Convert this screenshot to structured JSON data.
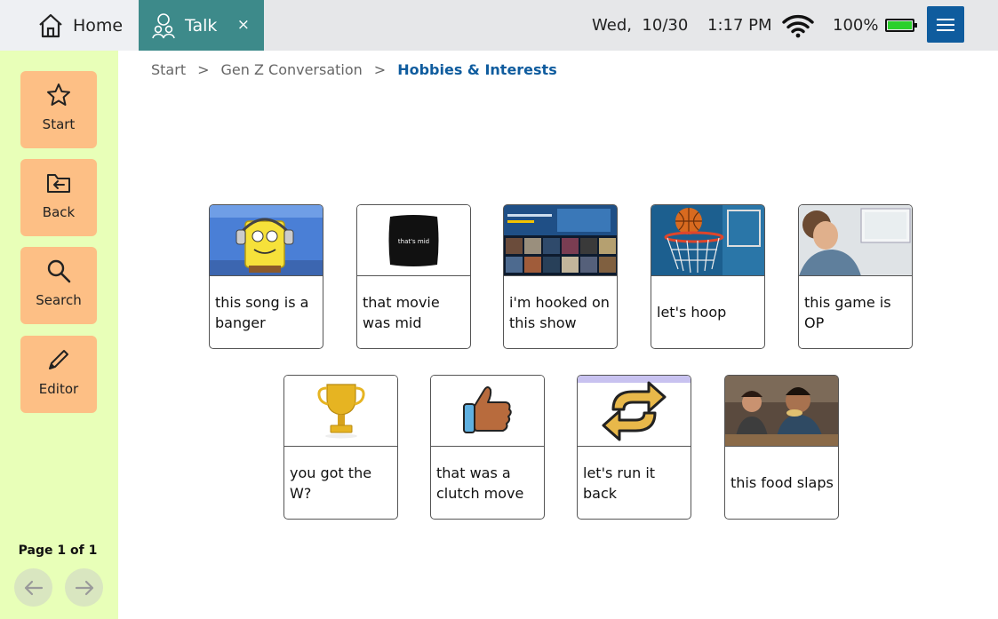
{
  "tabs": {
    "home_label": "Home",
    "talk_label": "Talk",
    "close_glyph": "×"
  },
  "status": {
    "date": "Wed,  10/30",
    "time": "1:17 PM",
    "battery": "100%",
    "battery_level": 1.0
  },
  "sidebar": {
    "buttons": [
      {
        "label": "Start",
        "icon": "star-icon"
      },
      {
        "label": "Back",
        "icon": "folder-back-icon"
      },
      {
        "label": "Search",
        "icon": "search-icon"
      },
      {
        "label": "Editor",
        "icon": "pencil-icon"
      }
    ],
    "page_info": "Page 1 of 1"
  },
  "breadcrumb": {
    "items": [
      "Start",
      "Gen Z Conversation",
      "Hobbies & Interests"
    ],
    "separator": ">"
  },
  "tiles": [
    {
      "caption": "this song is a banger"
    },
    {
      "caption": "that movie was mid",
      "image_text": "that's mid"
    },
    {
      "caption": "i'm hooked on this show"
    },
    {
      "caption": "let's hoop"
    },
    {
      "caption": "this game is OP"
    },
    {
      "caption": "you got the W?"
    },
    {
      "caption": "that was a clutch move"
    },
    {
      "caption": "let's run it back"
    },
    {
      "caption": "this food slaps"
    }
  ],
  "colors": {
    "accent": "#0f5c9e",
    "talk_tab": "#3d8a8a",
    "sidebar_bg": "#e8ffb8",
    "sidebar_button": "#fdbf85"
  }
}
